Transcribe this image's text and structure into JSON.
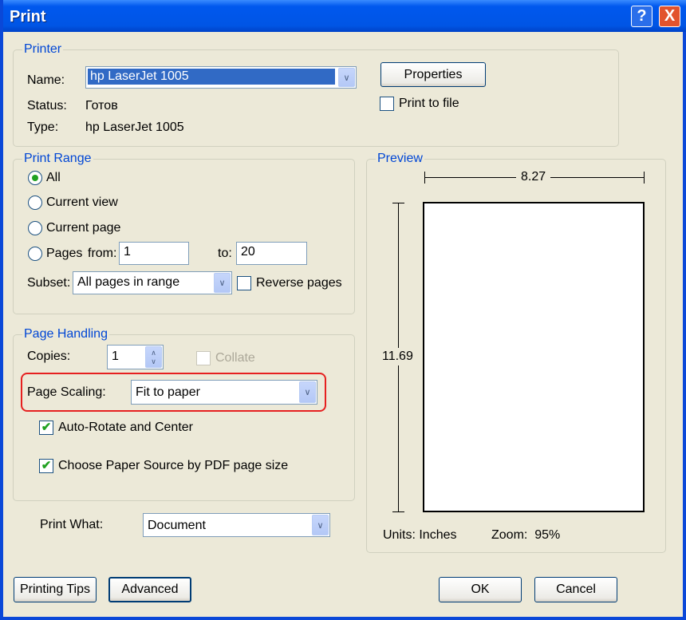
{
  "window": {
    "title": "Print",
    "help": "?",
    "close": "X"
  },
  "printer": {
    "legend": "Printer",
    "name_label": "Name:",
    "name_value": "hp LaserJet 1005",
    "status_label": "Status:",
    "status_value": "Готов",
    "type_label": "Type:",
    "type_value": "hp LaserJet 1005",
    "properties": "Properties",
    "print_to_file": "Print to file"
  },
  "range": {
    "legend": "Print Range",
    "all": "All",
    "current_view": "Current view",
    "current_page": "Current page",
    "pages": "Pages",
    "from": "from:",
    "from_value": "1",
    "to": "to:",
    "to_value": "20",
    "subset_label": "Subset:",
    "subset_value": "All pages in range",
    "reverse": "Reverse pages"
  },
  "handling": {
    "legend": "Page Handling",
    "copies_label": "Copies:",
    "copies_value": "1",
    "collate": "Collate",
    "scaling_label": "Page Scaling:",
    "scaling_value": "Fit to paper",
    "auto_rotate": "Auto-Rotate and Center",
    "paper_source": "Choose Paper Source by PDF page size"
  },
  "print_what": {
    "label": "Print What:",
    "value": "Document"
  },
  "preview": {
    "legend": "Preview",
    "width": "8.27",
    "height": "11.69",
    "units": "Units: Inches",
    "zoom": "Zoom:  95%"
  },
  "buttons": {
    "tips": "Printing Tips",
    "advanced": "Advanced",
    "ok": "OK",
    "cancel": "Cancel"
  }
}
